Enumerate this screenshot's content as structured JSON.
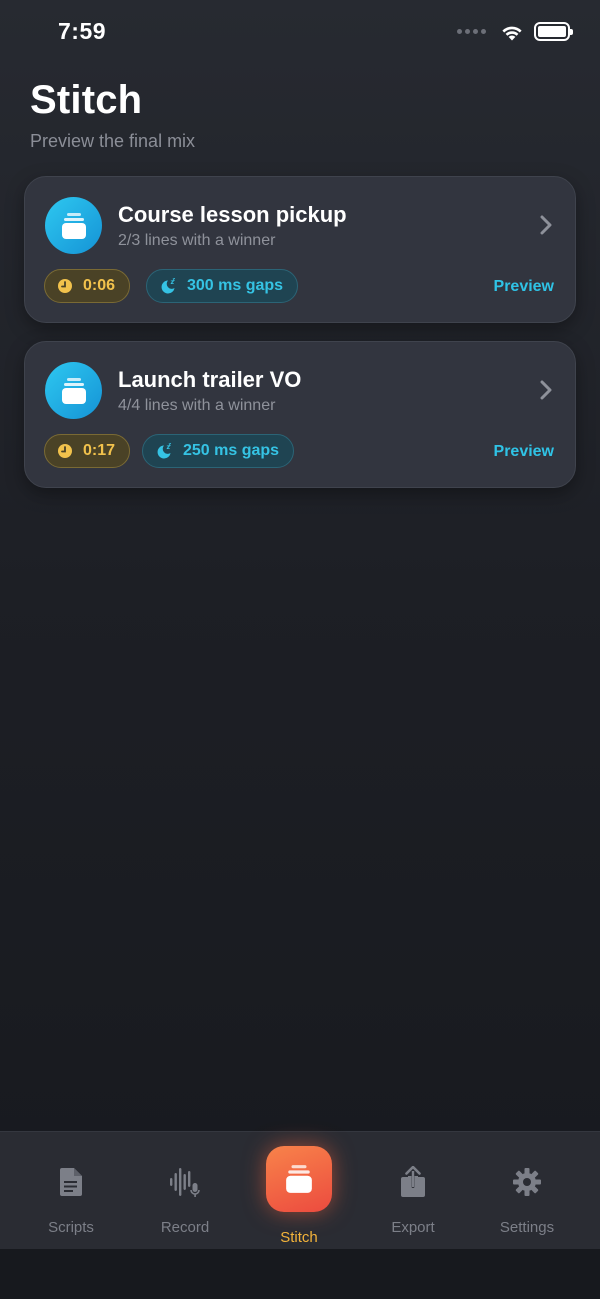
{
  "status_bar": {
    "time": "7:59"
  },
  "header": {
    "title": "Stitch",
    "subtitle": "Preview the final mix"
  },
  "projects": [
    {
      "title": "Course lesson pickup",
      "subtitle": "2/3 lines with a winner",
      "duration": "0:06",
      "gap": "300 ms gaps",
      "action": "Preview"
    },
    {
      "title": "Launch trailer VO",
      "subtitle": "4/4 lines with a winner",
      "duration": "0:17",
      "gap": "250 ms gaps",
      "action": "Preview"
    }
  ],
  "tab_bar": {
    "tabs": [
      {
        "label": "Scripts",
        "icon": "document-icon"
      },
      {
        "label": "Record",
        "icon": "waveform-mic-icon"
      },
      {
        "label": "Stitch",
        "icon": "stack-icon",
        "active": true
      },
      {
        "label": "Export",
        "icon": "share-icon"
      },
      {
        "label": "Settings",
        "icon": "gear-icon"
      }
    ]
  },
  "colors": {
    "accent_cyan": "#2fc3e6",
    "duration_amber": "#f2c24c",
    "active_tab": "#f3b33a",
    "stitch_gradient_start": "#f8834a",
    "stitch_gradient_end": "#ec4b3f"
  }
}
